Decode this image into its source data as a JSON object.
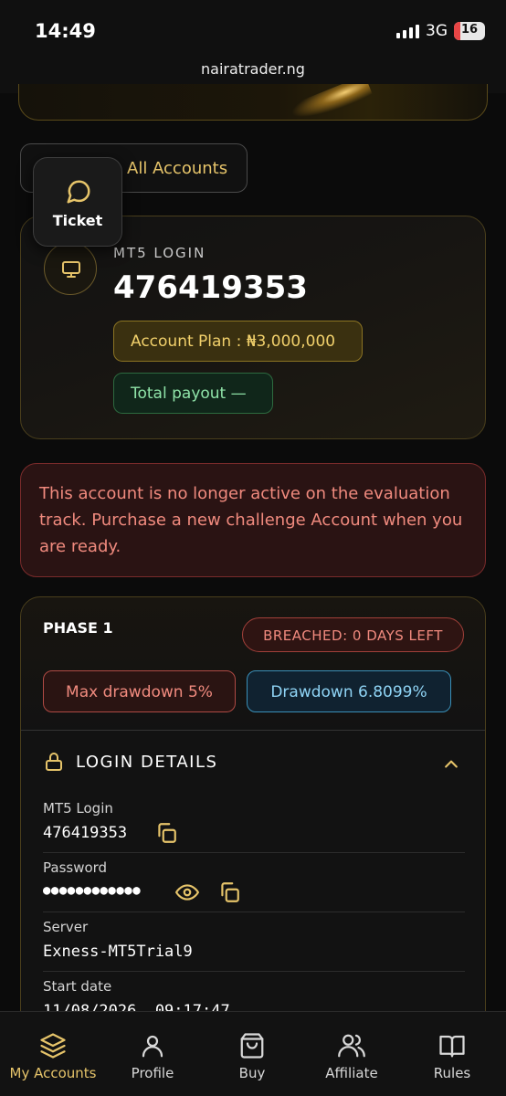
{
  "status_bar": {
    "time": "14:49",
    "network": "3G",
    "battery": "16"
  },
  "browser": {
    "url": "nairatrader.ng"
  },
  "accounts_button": {
    "label": "All Accounts"
  },
  "ticket": {
    "label": "Ticket",
    "icon": "chat-bubble-icon"
  },
  "account": {
    "login_label": "MT5 LOGIN",
    "login_number": "476419353",
    "plan": "Account Plan : ₦3,000,000",
    "payout": "Total payout —"
  },
  "alert": {
    "message": "This account is no longer active on the evaluation track. Purchase a new challenge Account when you are ready."
  },
  "phase": {
    "title": "PHASE 1",
    "status": "BREACHED: 0 DAYS LEFT",
    "max_drawdown": "Max drawdown 5%",
    "drawdown": "Drawdown 6.8099%"
  },
  "login_details": {
    "heading": "LOGIN DETAILS",
    "fields": [
      {
        "label": "MT5 Login",
        "value": "476419353"
      },
      {
        "label": "Password",
        "value": "●●●●●●●●●●●●"
      },
      {
        "label": "Server",
        "value": "Exness-MT5Trial9"
      },
      {
        "label": "Start date",
        "value": "11/08/2026, 09:17:47"
      }
    ]
  },
  "nav": {
    "items": [
      {
        "label": "My Accounts",
        "icon": "layers-icon",
        "active": true
      },
      {
        "label": "Profile",
        "icon": "user-icon"
      },
      {
        "label": "Buy",
        "icon": "shopping-bag-icon"
      },
      {
        "label": "Affiliate",
        "icon": "users-icon"
      },
      {
        "label": "Rules",
        "icon": "book-icon"
      }
    ]
  },
  "colors": {
    "gold": "#e6c46a",
    "danger": "#f08a7e",
    "info": "#8fd4f5",
    "success": "#8fe3a8"
  }
}
